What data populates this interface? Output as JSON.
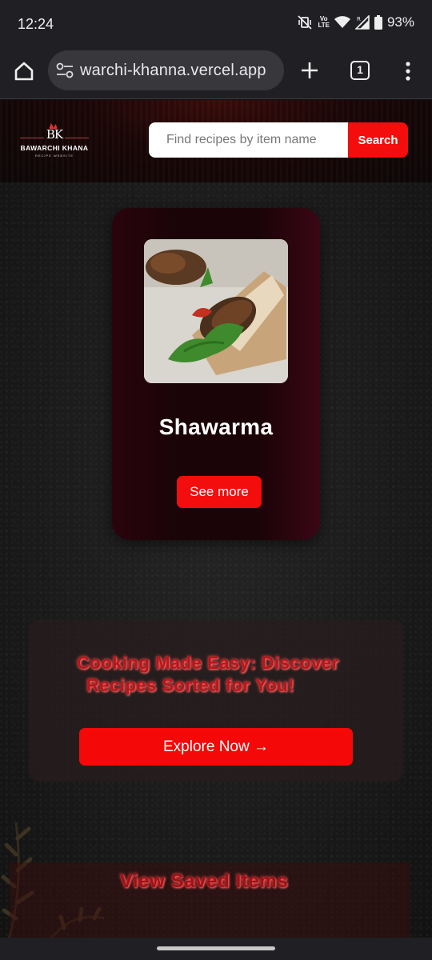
{
  "status_bar": {
    "time": "12:24",
    "battery": "93%",
    "network_label_top": "Vo",
    "network_label_bottom": "LTE",
    "icons": [
      "vibrate-off-icon",
      "volte-icon",
      "wifi-icon",
      "signal-icon",
      "battery-icon"
    ]
  },
  "browser": {
    "url": "warchi-khanna.vercel.app",
    "tab_count": "1",
    "icons": [
      "home-icon",
      "site-settings-icon",
      "new-tab-icon",
      "tabs-icon",
      "more-menu-icon"
    ]
  },
  "site": {
    "logo_initials": "BK",
    "logo_name": "BAWARCHI KHANA",
    "logo_tagline": "RECIPE WEBSITE",
    "search_placeholder": "Find recipes by item name",
    "search_button": "Search"
  },
  "recipe_card": {
    "title": "Shawarma",
    "button": "See more"
  },
  "promo": {
    "line1": "Cooking Made Easy: Discover",
    "line2": "Recipes Sorted for You!",
    "button": "Explore Now →"
  },
  "saved": {
    "label": "View Saved Items"
  },
  "colors": {
    "accent_red": "#f40d0d",
    "card_dark": "#1a0408",
    "glow_text": "#b8161a"
  }
}
